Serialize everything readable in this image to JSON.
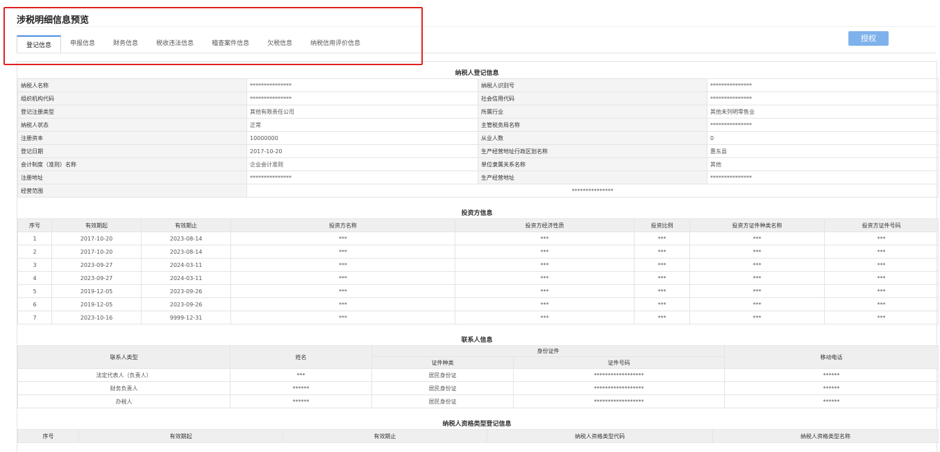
{
  "page_title": "涉税明细信息预览",
  "tabs": [
    "登记信息",
    "申报信息",
    "财务信息",
    "税收违法信息",
    "稽查案件信息",
    "欠税信息",
    "纳税信用评价信息"
  ],
  "auth_button": "授权",
  "registration": {
    "title": "纳税人登记信息",
    "rows": [
      [
        "纳税人名称",
        "***************",
        "纳税人识别号",
        "***************"
      ],
      [
        "组织机构代码",
        "***************",
        "社会信用代码",
        "***************"
      ],
      [
        "登记注册类型",
        "其他有限责任公司",
        "所属行业",
        "其他未列明零售业"
      ],
      [
        "纳税人状态",
        "正常",
        "主管税务局名称",
        "***************"
      ],
      [
        "注册资本",
        "10000000",
        "从业人数",
        "0"
      ],
      [
        "登记日期",
        "2017-10-20",
        "生产经营地址行政区划名称",
        "惠东县"
      ],
      [
        "会计制度（准则）名称",
        "企业会计准则",
        "单位隶属关系名称",
        "其他"
      ],
      [
        "注册地址",
        "***************",
        "生产经营地址",
        "***************"
      ]
    ],
    "scope_label": "经营范围",
    "scope_value": "***************"
  },
  "investors": {
    "title": "投资方信息",
    "headers": [
      "序号",
      "有效期起",
      "有效期止",
      "投资方名称",
      "投资方经济性质",
      "投资比例",
      "投资方证件种类名称",
      "投资方证件号码"
    ],
    "rows": [
      [
        "1",
        "2017-10-20",
        "2023-08-14",
        "***",
        "***",
        "***",
        "***",
        "***"
      ],
      [
        "2",
        "2017-10-20",
        "2023-08-14",
        "***",
        "***",
        "***",
        "***",
        "***"
      ],
      [
        "3",
        "2023-09-27",
        "2024-03-11",
        "***",
        "***",
        "***",
        "***",
        "***"
      ],
      [
        "4",
        "2023-09-27",
        "2024-03-11",
        "***",
        "***",
        "***",
        "***",
        "***"
      ],
      [
        "5",
        "2019-12-05",
        "2023-09-26",
        "***",
        "***",
        "***",
        "***",
        "***"
      ],
      [
        "6",
        "2019-12-05",
        "2023-09-26",
        "***",
        "***",
        "***",
        "***",
        "***"
      ],
      [
        "7",
        "2023-10-16",
        "9999-12-31",
        "***",
        "***",
        "***",
        "***",
        "***"
      ]
    ]
  },
  "contacts": {
    "title": "联系人信息",
    "h_type": "联系人类型",
    "h_name": "姓名",
    "h_id": "身份证件",
    "h_id_kind": "证件种类",
    "h_id_no": "证件号码",
    "h_phone": "移动电话",
    "rows": [
      [
        "法定代表人（负责人）",
        "***",
        "居民身份证",
        "******************",
        "******"
      ],
      [
        "财务负责人",
        "******",
        "居民身份证",
        "******************",
        "******"
      ],
      [
        "办税人",
        "******",
        "居民身份证",
        "******************",
        "******"
      ]
    ]
  },
  "qualification": {
    "title": "纳税人资格类型登记信息",
    "headers": [
      "序号",
      "有效期起",
      "有效期止",
      "纳税人资格类型代码",
      "纳税人资格类型名称"
    ]
  }
}
